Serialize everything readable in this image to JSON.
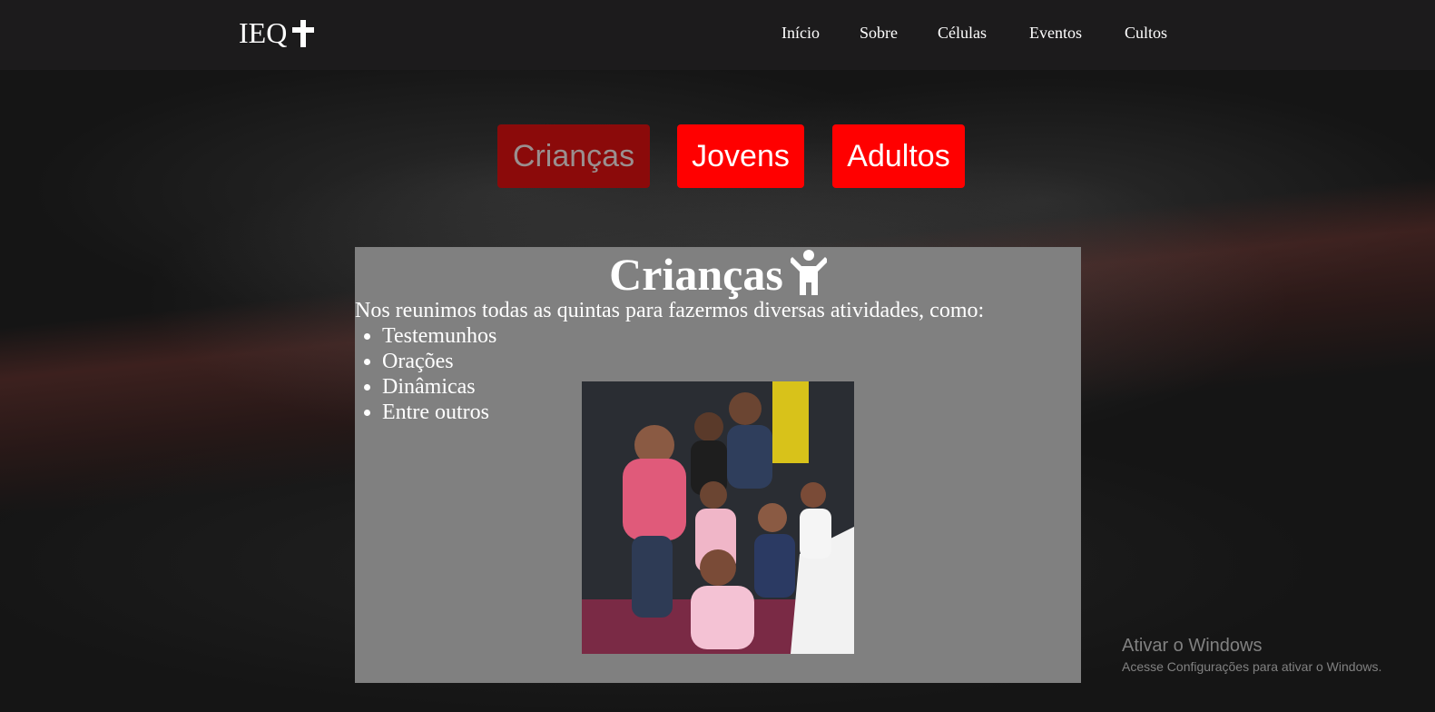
{
  "navbar": {
    "logo_text": "IEQ",
    "links": [
      "Início",
      "Sobre",
      "Células",
      "Eventos",
      "Cultos"
    ]
  },
  "tabs": {
    "items": [
      "Crianças",
      "Jovens",
      "Adultos"
    ],
    "active": "Crianças"
  },
  "panel": {
    "title": "Crianças",
    "intro": "Nos reunimos todas as quintas para fazermos diversas atividades, como:",
    "activities": [
      "Testemunhos",
      "Orações",
      "Dinâmicas",
      "Entre outros"
    ]
  },
  "watermark": {
    "title": "Ativar o Windows",
    "subtitle": "Acesse Configurações para ativar o Windows."
  },
  "colors": {
    "navbar_bg": "#1c1b1c",
    "tab_bg": "#ff0000",
    "tab_active_bg": "#8b0a0a",
    "panel_bg": "#808080"
  },
  "icons": {
    "logo": "cross-icon",
    "panel_title": "child-icon"
  }
}
